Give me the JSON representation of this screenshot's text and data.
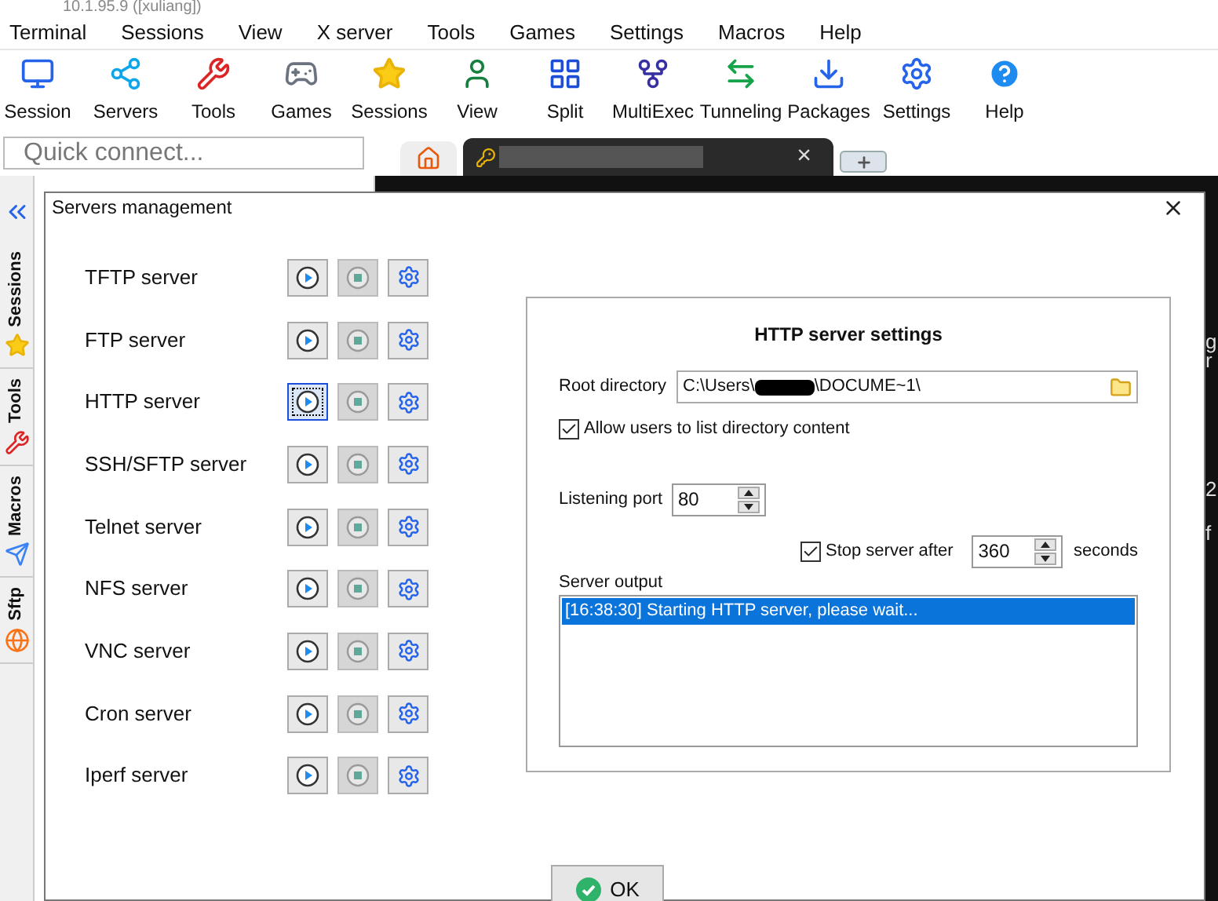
{
  "window": {
    "title": "10.1.95.9 ([xuliang])"
  },
  "menu": [
    "Terminal",
    "Sessions",
    "View",
    "X server",
    "Tools",
    "Games",
    "Settings",
    "Macros",
    "Help"
  ],
  "toolbar": [
    "Session",
    "Servers",
    "Tools",
    "Games",
    "Sessions",
    "View",
    "Split",
    "MultiExec",
    "Tunneling",
    "Packages",
    "Settings",
    "Help"
  ],
  "quick_connect": {
    "placeholder": "Quick connect..."
  },
  "tab_bar": {
    "close": "×"
  },
  "side_tabs": [
    "Sessions",
    "Tools",
    "Macros",
    "Sftp"
  ],
  "terminal_fragments": [
    "g",
    "r",
    "2",
    "f"
  ],
  "dialog": {
    "title": "Servers management",
    "servers": [
      {
        "name": "TFTP server",
        "focused": false
      },
      {
        "name": "FTP server",
        "focused": false
      },
      {
        "name": "HTTP server",
        "focused": true
      },
      {
        "name": "SSH/SFTP server",
        "focused": false
      },
      {
        "name": "Telnet server",
        "focused": false
      },
      {
        "name": "NFS server",
        "focused": false
      },
      {
        "name": "VNC server",
        "focused": false
      },
      {
        "name": "Cron server",
        "focused": false
      },
      {
        "name": "Iperf server",
        "focused": false
      }
    ],
    "settings": {
      "title": "HTTP server settings",
      "root_label": "Root directory",
      "root_start": "C:\\Users\\",
      "root_end": "\\DOCUME~1\\",
      "list_dir": {
        "label": "Allow users to list directory content",
        "checked": true
      },
      "port_label": "Listening port",
      "port": "80",
      "stop_after": {
        "label": "Stop server after",
        "checked": true
      },
      "stop_value": "360",
      "stop_unit": "seconds",
      "output_label": "Server output",
      "output": [
        {
          "text": "[16:38:30] Starting HTTP server, please wait...",
          "selected": true
        }
      ]
    },
    "ok": "OK"
  }
}
